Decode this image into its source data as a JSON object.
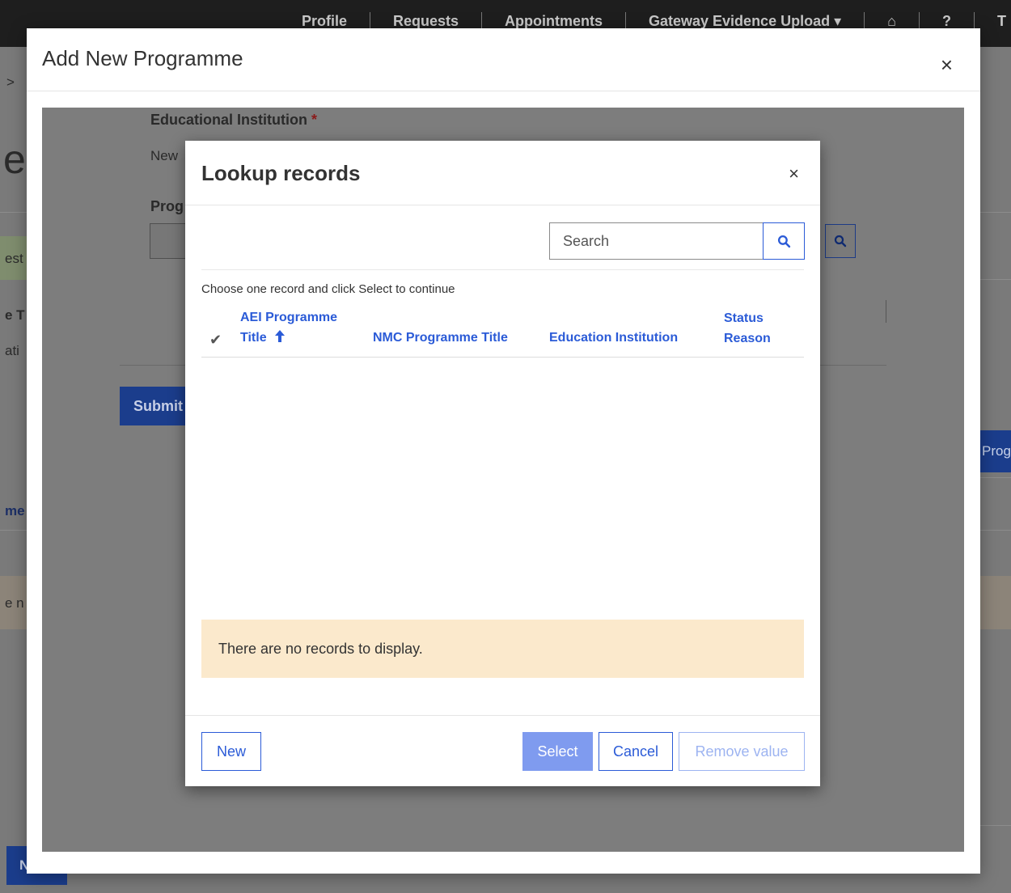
{
  "top_nav": {
    "items": [
      "Profile",
      "Requests",
      "Appointments",
      "Gateway Evidence Upload ▾",
      "⌂",
      "?",
      "T"
    ]
  },
  "background_fragments": {
    "breadcrumb_sep": ">",
    "big_letter": "e",
    "frag_est": "est",
    "frag_et": "e T",
    "frag_ati": "ati",
    "frag_prog": "Prog",
    "frag_me": "me",
    "frag_en": "e n",
    "frag_n": "N"
  },
  "outer_modal": {
    "title": "Add New Programme",
    "close_label": "×",
    "educational_institution_label": "Educational Institution",
    "required_marker": "*",
    "institution_value_fragment": "New",
    "programme_label_fragment": "Prog",
    "submit_fragment": "Submit"
  },
  "lookup_modal": {
    "title": "Lookup records",
    "close_label": "×",
    "search": {
      "placeholder": "Search",
      "value": ""
    },
    "instruction": "Choose one record and click Select to continue",
    "columns": {
      "check": "✔",
      "aei_title_line1": "AEI Programme",
      "aei_title_line2": "Title",
      "sort_arrow": "🡑",
      "nmc_title": "NMC Programme Title",
      "education_institution": "Education Institution",
      "status_line1": "Status",
      "status_line2": "Reason"
    },
    "empty_message": "There are no records to display.",
    "buttons": {
      "new": "New",
      "select": "Select",
      "cancel": "Cancel",
      "remove": "Remove value"
    }
  },
  "colors": {
    "accent": "#2b5bd7",
    "select_disabled": "#7f9bef",
    "empty_banner": "#fbe9cc",
    "overlay_gray": "#7a7a7a",
    "topbar": "#1e1e1e"
  }
}
